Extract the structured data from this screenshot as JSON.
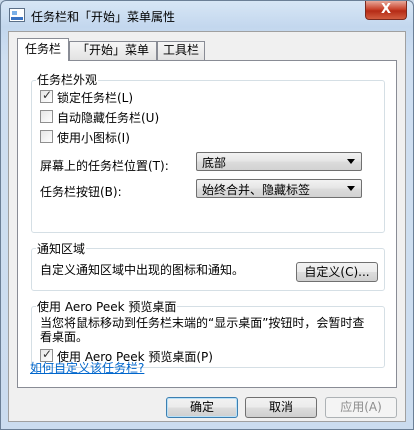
{
  "window": {
    "title": "任务栏和「开始」菜单属性",
    "close_glyph": "X"
  },
  "tabs": [
    {
      "label": "任务栏",
      "active": true
    },
    {
      "label": "「开始」菜单",
      "active": false
    },
    {
      "label": "工具栏",
      "active": false
    }
  ],
  "appearance": {
    "title": "任务栏外观",
    "lock": {
      "label": "锁定任务栏(L)",
      "checked": true
    },
    "autohide": {
      "label": "自动隐藏任务栏(U)",
      "checked": false
    },
    "small_icons": {
      "label": "使用小图标(I)",
      "checked": false
    },
    "location_label": "屏幕上的任务栏位置(T):",
    "location_value": "底部",
    "buttons_label": "任务栏按钮(B):",
    "buttons_value": "始终合并、隐藏标签"
  },
  "notification": {
    "title": "通知区域",
    "description": "自定义通知区域中出现的图标和通知。",
    "customize_button": "自定义(C)..."
  },
  "aero_peek": {
    "title": "使用 Aero Peek 预览桌面",
    "description": "当您将鼠标移动到任务栏末端的“显示桌面”按钮时，会暂时查看桌面。",
    "checkbox": {
      "label": "使用 Aero Peek 预览桌面(P)",
      "checked": true
    }
  },
  "help_link": "如何自定义该任务栏?",
  "footer": {
    "ok": "确定",
    "cancel": "取消",
    "apply": "应用(A)"
  },
  "check_glyph": "✓"
}
